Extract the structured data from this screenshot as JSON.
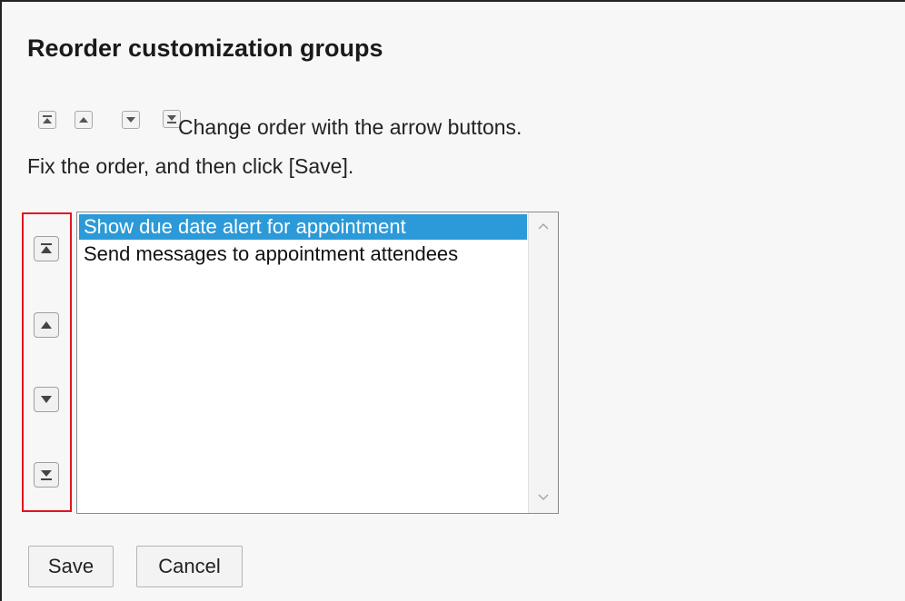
{
  "page": {
    "title": "Reorder customization groups",
    "hint_line1": "Change order with the arrow buttons.",
    "hint_line2": "Fix the order, and then click [Save]."
  },
  "legend_icons": [
    "move-to-top-icon",
    "move-up-icon",
    "move-down-icon",
    "move-to-bottom-icon"
  ],
  "order_buttons": [
    {
      "name": "move-to-top-button",
      "icon": "move-to-top-icon"
    },
    {
      "name": "move-up-button",
      "icon": "move-up-icon"
    },
    {
      "name": "move-down-button",
      "icon": "move-down-icon"
    },
    {
      "name": "move-to-bottom-button",
      "icon": "move-to-bottom-icon"
    }
  ],
  "listbox": {
    "items": [
      {
        "label": "Show due date alert for appointment",
        "selected": true
      },
      {
        "label": "Send messages to appointment attendees",
        "selected": false
      }
    ]
  },
  "actions": {
    "save_label": "Save",
    "cancel_label": "Cancel"
  },
  "colors": {
    "highlight_border": "#e0141e",
    "selection_bg": "#2c9ad8"
  }
}
